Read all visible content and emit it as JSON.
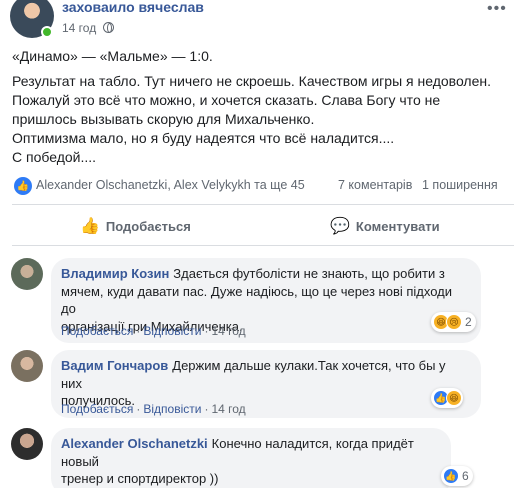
{
  "post": {
    "author": "заховаило вячеслав",
    "time": "14 год",
    "more": "•••",
    "score_line": "«Динамо» — «Мальме» — 1:0.",
    "text": "Результат на табло. Тут ничего не скроешь. Качеством игры я недоволен.\nПожалуй это всё что можно, и хочется сказать. Слава Богу что не\nпришлось вызывать скорую для Михальченко.\nОптимизма мало, но я буду надеятся что всё наладится....\nС победой...."
  },
  "stats": {
    "reactors": "Alexander Olschanetzki, Alex Velykykh та ще 45",
    "comments": "7 коментарів",
    "shares": "1 поширення"
  },
  "actions": {
    "like_label": "Подобається",
    "comment_label": "Коментувати"
  },
  "comments": [
    {
      "name": "Владимир Козин",
      "text": "Здається футболісти не знають, що робити з\nмячем, куди давати пас. Дуже надіюсь, що це через нові підходи до\nорганізації гри Михайличенка.",
      "like": "Подобається",
      "reply": "Відповісти",
      "time": "14 год",
      "reaction_count": "2"
    },
    {
      "name": "Вадим Гончаров",
      "text": "Держим дальше кулаки.Так хочется, что бы у них\nполучилось.",
      "like": "Подобається",
      "reply": "Відповісти",
      "time": "14 год",
      "reaction_count": ""
    },
    {
      "name": "Alexander Olschanetzki",
      "text": "Конечно наладится, когда придёт новый\nтренер и спортдиректор ))",
      "like": "",
      "reply": "",
      "time": "",
      "reaction_count": "6"
    }
  ],
  "colors": {
    "link_blue": "#385898",
    "like_blue": "#2e7bf6",
    "bubble_gray": "#f2f3f5",
    "online_green": "#42b72a"
  },
  "icons": [
    "globe-icon",
    "more-icon",
    "like-icon",
    "comment-icon",
    "haha-icon",
    "sad-icon"
  ]
}
